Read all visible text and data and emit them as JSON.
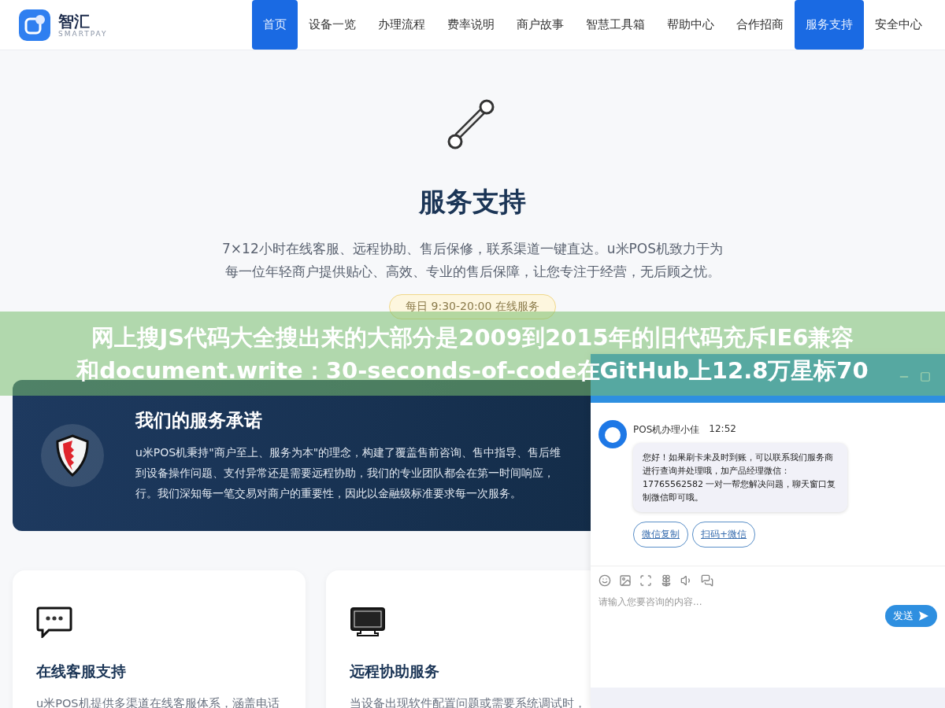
{
  "brand": {
    "name": "智汇",
    "sub": "SMARTPAY"
  },
  "nav": [
    {
      "label": "首页",
      "selected": true
    },
    {
      "label": "设备一览",
      "selected": false
    },
    {
      "label": "办理流程",
      "selected": false
    },
    {
      "label": "费率说明",
      "selected": false
    },
    {
      "label": "商户故事",
      "selected": false
    },
    {
      "label": "智慧工具箱",
      "selected": false
    },
    {
      "label": "帮助中心",
      "selected": false
    },
    {
      "label": "合作招商",
      "selected": false
    },
    {
      "label": "服务支持",
      "selected": true
    },
    {
      "label": "安全中心",
      "selected": false
    }
  ],
  "hero": {
    "title": "服务支持",
    "text": "7×12小时在线客服、远程协助、售后保修，联系渠道一键直达。u米POS机致力于为每一位年轻商户提供贴心、高效、专业的售后保障，让您专注于经营，无后顾之忧。",
    "hours": "每日 9:30-20:00 在线服务"
  },
  "banner": {
    "lines": [
      "网上搜JS代码大全搜出来的大部分是2009到2015年的旧代码充斥IE6兼容",
      "和document.write：30-seconds-of-code在GitHub上12.8万星标70"
    ]
  },
  "promise": {
    "title": "我们的服务承诺",
    "lines": [
      "u米POS机秉持\"商户至上、服务为本\"的理念，构建了覆盖售前咨询、售中指导、售后维",
      "到设备操作问题、支付异常还是需要远程协助，我们的专业团队都会在第一时间响应，",
      "行。我们深知每一笔交易对商户的重要性，因此以金融级标准要求每一次服务。"
    ]
  },
  "cards": [
    {
      "kind": "chat",
      "title": "在线客服支持",
      "text": "u米POS机提供多渠道在线客服体系，涵盖电话"
    },
    {
      "kind": "monitor",
      "title": "远程协助服务",
      "text": "当设备出现软件配置问题或需要系统调试时，"
    }
  ],
  "chat": {
    "sender": "POS机办理小佳",
    "time": "12:52",
    "message": "您好！如果刷卡未及时到账，可以联系我们服务商进行查询并处理哦，加产品经理微信：17765562582 一对一帮您解决问题，聊天窗口复制微信即可哦。",
    "actions": [
      "微信复制",
      "扫码+微信"
    ],
    "placeholder": "请输入您要咨询的内容...",
    "send": "发送"
  }
}
